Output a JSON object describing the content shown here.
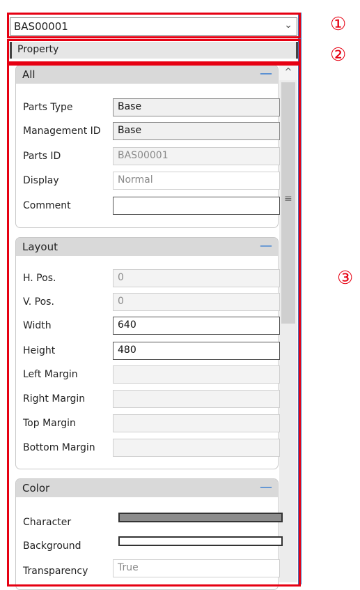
{
  "selector": {
    "value": "BAS00001",
    "arrow_icon": "chevron-down-icon"
  },
  "property_header": {
    "label": "Property"
  },
  "markers": {
    "one": "①",
    "two": "②",
    "three": "③"
  },
  "sections": {
    "all": {
      "title": "All",
      "collapse": "—",
      "rows": [
        {
          "label": "Parts Type",
          "value": "Base"
        },
        {
          "label": "Management ID",
          "value": "Base"
        },
        {
          "label": "Parts ID",
          "value": "BAS00001"
        },
        {
          "label": "Display",
          "value": "Normal"
        },
        {
          "label": "Comment",
          "value": ""
        }
      ]
    },
    "layout": {
      "title": "Layout",
      "collapse": "—",
      "rows": [
        {
          "label": "H. Pos.",
          "value": "0"
        },
        {
          "label": "V. Pos.",
          "value": "0"
        },
        {
          "label": "Width",
          "value": "640"
        },
        {
          "label": "Height",
          "value": "480"
        },
        {
          "label": "Left Margin",
          "value": ""
        },
        {
          "label": "Right Margin",
          "value": ""
        },
        {
          "label": "Top Margin",
          "value": ""
        },
        {
          "label": "Bottom Margin",
          "value": ""
        }
      ]
    },
    "color": {
      "title": "Color",
      "collapse": "—",
      "rows": [
        {
          "label": "Character",
          "swatch": "#8c8c8c"
        },
        {
          "label": "Background",
          "swatch": "#ffffff"
        },
        {
          "label": "Transparency",
          "value": "True"
        }
      ]
    }
  },
  "scrollbar": {
    "up_arrow": "^",
    "grip": "≡"
  },
  "colors": {
    "highlight": "#e60012",
    "accent": "#1f6fd1",
    "panel_edge": "#3f79c2"
  }
}
